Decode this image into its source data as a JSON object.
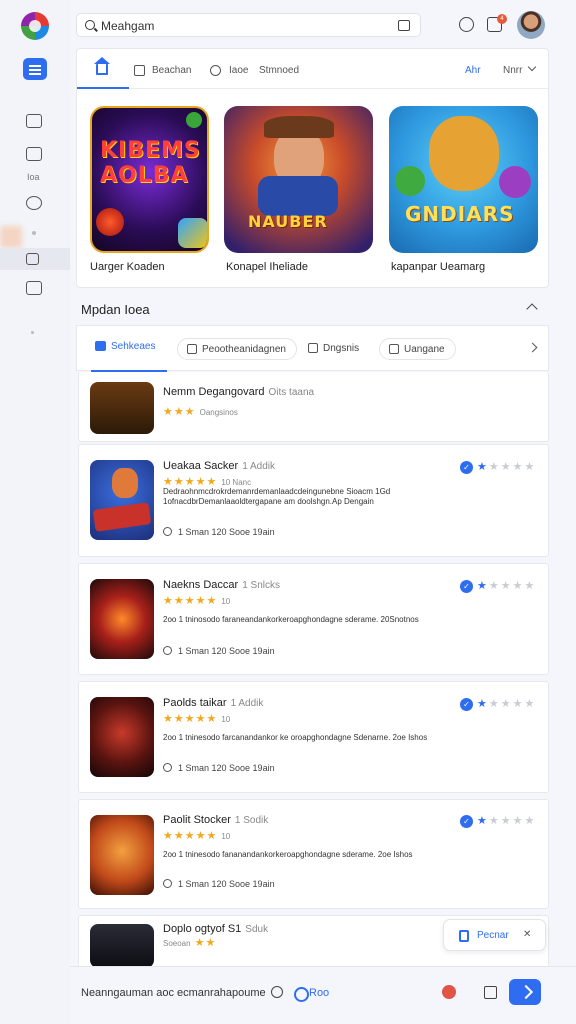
{
  "search": {
    "value": "Meahgam"
  },
  "header": {
    "notification_count": "4"
  },
  "sidebar": {
    "label": "Ioa"
  },
  "featured_tabs": {
    "tab1": "Beachan",
    "tab2": "Iaoe",
    "tab3": "Stmnoed",
    "right1": "Ahr",
    "right2": "Nnrr"
  },
  "featured": [
    {
      "title": "Uarger Koaden",
      "art": "KIBEMS AOLBA",
      "caption": ""
    },
    {
      "title": "Konapel Iheliade",
      "art": "NAUBER",
      "caption": ""
    },
    {
      "title": "kapanpar Ueamarg",
      "art": "GNDIARS",
      "caption": ""
    }
  ],
  "section": {
    "title": "Mpdan Ioea"
  },
  "filter_tabs": {
    "active": "Sehkeaes",
    "tab2": "Peootheanidagnen",
    "tab3": "Dngsnis",
    "tab4": "Uangane"
  },
  "list_items": [
    {
      "title": "Nemm Degangovard",
      "sub": "Oits taana",
      "stars": "★★★",
      "stars_note": "Oangsinos",
      "desc": "",
      "meta": ""
    },
    {
      "title": "Ueakaa Sacker",
      "sub": "1 Addik",
      "stars": "★★★★★",
      "stars_note": "10 Nanc",
      "desc": "Dedraohnmcdrokrdemanrdemanlaadcdeingunebne Sioacm 1Gd 1ofnacdbrDemanlaaoldtergapane am doolshgn.Ap Dengain",
      "meta": "1 Sman  120 Sooe  19ain",
      "rating": "1"
    },
    {
      "title": "Naekns Daccar",
      "sub": "1 Snlcks",
      "stars": "★★★★★",
      "stars_note": "10",
      "desc": "2oo 1 tninosodo faraneandankorkeroapghondagne sderame. 20Snotnos",
      "meta": "1 Sman  120 Sooe  19ain",
      "rating": "1"
    },
    {
      "title": "Paolds taikar",
      "sub": "1 Addik",
      "stars": "★★★★★",
      "stars_note": "10",
      "desc": "2oo 1 tninesodo farcanandankor ke oroapghondagne Sdenarne. 2oe Ishos",
      "meta": "1 Sman  120 Sooe  19ain",
      "rating": "1"
    },
    {
      "title": "Paolit Stocker",
      "sub": "1 Sodik",
      "stars": "★★★★★",
      "stars_note": "10",
      "desc": "2oo 1 tninesodo fananandankorkeroapghondagne sderame. 2oe Ishos",
      "meta": "1 Sman  120 Sooe  19ain",
      "rating": "1"
    },
    {
      "title": "Doplo ogtyof S1",
      "sub": "Sduk",
      "stars_note": "Soeoan",
      "stars": "★★",
      "desc": "",
      "meta": ""
    }
  ],
  "float_button": {
    "label": "Pecnar"
  },
  "bottom": {
    "text": "Neanngauman aoc ecmanrahapoume",
    "link": "Roo"
  },
  "colors": {
    "accent": "#2f6df0",
    "star": "#f2a81d",
    "badge": "#e85a3c"
  }
}
